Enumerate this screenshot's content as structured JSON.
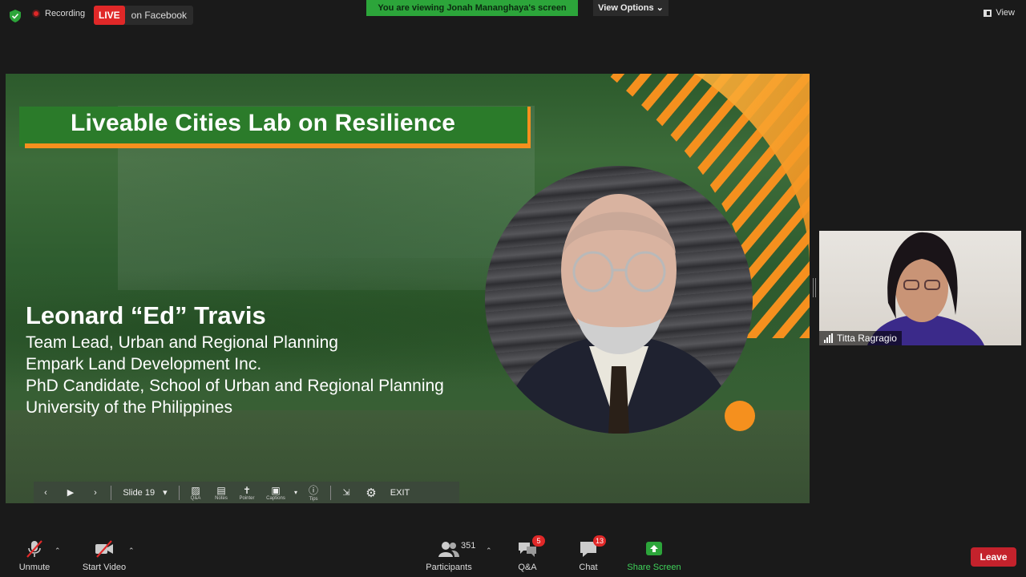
{
  "topbar": {
    "recording_label": "Recording",
    "live_badge": "LIVE",
    "live_platform": "on Facebook",
    "viewing_banner": "You are viewing Jonah Mananghaya's screen",
    "view_options_label": "View Options",
    "view_label": "View"
  },
  "slide": {
    "title": "Liveable Cities Lab on Resilience",
    "speaker_name": "Leonard “Ed” Travis",
    "speaker_lines": [
      "Team Lead, Urban and Regional Planning",
      "Empark Land Development Inc.",
      "PhD Candidate, School of Urban and Regional Planning",
      "University of the Philippines"
    ],
    "toolbar": {
      "slide_label": "Slide 19",
      "qa_label": "Q&A",
      "notes_label": "Notes",
      "pointer_label": "Pointer",
      "captions_label": "Captions",
      "tips_label": "Tips",
      "exit_label": "EXIT"
    }
  },
  "participant_thumb": {
    "name": "Titta Ragragio"
  },
  "bottombar": {
    "unmute_label": "Unmute",
    "start_video_label": "Start Video",
    "participants_label": "Participants",
    "participants_count": "351",
    "qa_label": "Q&A",
    "qa_badge": "5",
    "chat_label": "Chat",
    "chat_badge": "13",
    "share_label": "Share Screen",
    "leave_label": "Leave"
  },
  "colors": {
    "accent_green": "#2ca53a",
    "title_orange": "#f5901e",
    "leave_red": "#c4222c"
  }
}
